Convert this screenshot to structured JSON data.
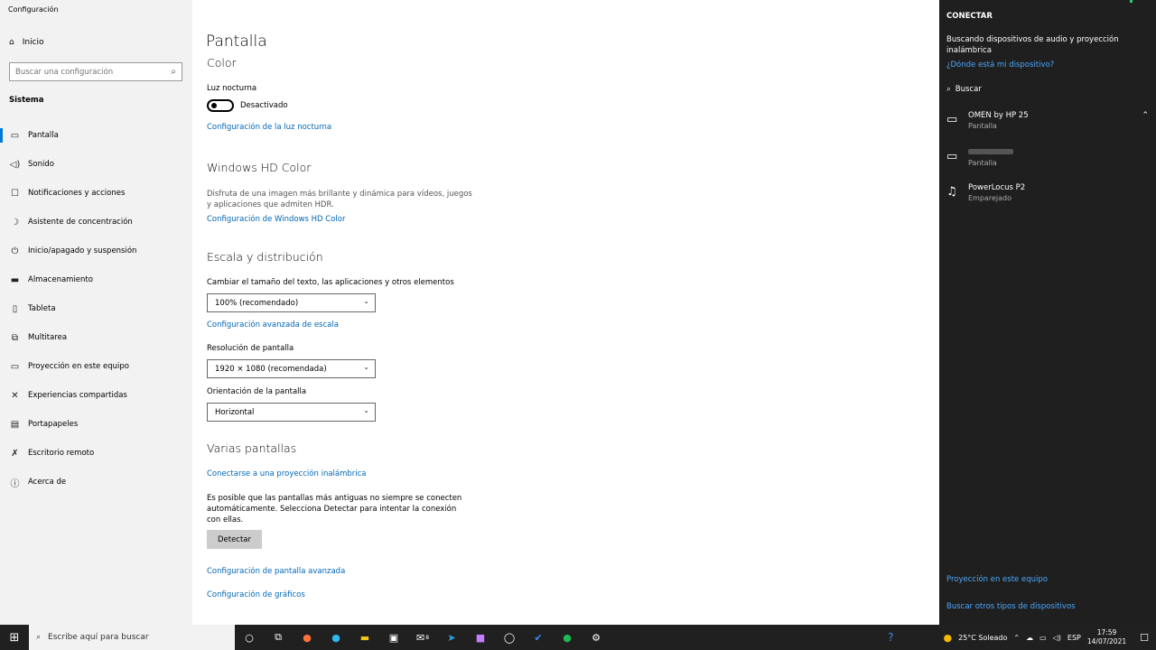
{
  "window": {
    "title": "Configuración"
  },
  "sidebar": {
    "home_label": "Inicio",
    "search_placeholder": "Buscar una configuración",
    "section_label": "Sistema",
    "items": [
      {
        "label": "Pantalla",
        "icon": "monitor-icon"
      },
      {
        "label": "Sonido",
        "icon": "speaker-icon"
      },
      {
        "label": "Notificaciones y acciones",
        "icon": "notification-icon"
      },
      {
        "label": "Asistente de concentración",
        "icon": "moon-icon"
      },
      {
        "label": "Inicio/apagado y suspensión",
        "icon": "power-icon"
      },
      {
        "label": "Almacenamiento",
        "icon": "storage-icon"
      },
      {
        "label": "Tableta",
        "icon": "tablet-icon"
      },
      {
        "label": "Multitarea",
        "icon": "multitask-icon"
      },
      {
        "label": "Proyección en este equipo",
        "icon": "projection-icon"
      },
      {
        "label": "Experiencias compartidas",
        "icon": "shared-icon"
      },
      {
        "label": "Portapapeles",
        "icon": "clipboard-icon"
      },
      {
        "label": "Escritorio remoto",
        "icon": "remote-icon"
      },
      {
        "label": "Acerca de",
        "icon": "info-icon"
      }
    ]
  },
  "main": {
    "title": "Pantalla",
    "color": {
      "heading": "Color",
      "night_light_label": "Luz nocturna",
      "night_light_state": "Desactivado",
      "night_light_link": "Configuración de la luz nocturna"
    },
    "hd_color": {
      "heading": "Windows HD Color",
      "description": "Disfruta de una imagen más brillante y dinámica para vídeos, juegos y aplicaciones que admiten HDR.",
      "link": "Configuración de Windows HD Color"
    },
    "scale": {
      "heading": "Escala y distribución",
      "size_label": "Cambiar el tamaño del texto, las aplicaciones y otros elementos",
      "size_value": "100% (recomendado)",
      "advanced_link": "Configuración avanzada de escala",
      "resolution_label": "Resolución de pantalla",
      "resolution_value": "1920 × 1080 (recomendada)",
      "orientation_label": "Orientación de la pantalla",
      "orientation_value": "Horizontal"
    },
    "multi": {
      "heading": "Varias pantallas",
      "wireless_link": "Conectarse a una proyección inalámbrica",
      "description": "Es posible que las pantallas más antiguas no siempre se conecten automáticamente. Selecciona Detectar para intentar la conexión con ellas.",
      "detect_button": "Detectar",
      "advanced_display_link": "Configuración de pantalla avanzada",
      "graphics_link": "Configuración de gráficos"
    }
  },
  "connect_panel": {
    "title": "CONECTAR",
    "description": "Buscando dispositivos de audio y proyección inalámbrica",
    "where_link": "¿Dónde está mi dispositivo?",
    "search_label": "Buscar",
    "devices": [
      {
        "name": "OMEN by HP 25",
        "type": "Pantalla",
        "icon": "monitor-icon"
      },
      {
        "name": "",
        "type": "Pantalla",
        "icon": "monitor-icon"
      },
      {
        "name": "PowerLocus P2",
        "type": "Emparejado",
        "icon": "headset-icon"
      }
    ],
    "projection_link": "Proyección en este equipo",
    "other_devices_link": "Buscar otros tipos de dispositivos"
  },
  "taskbar": {
    "search_placeholder": "Escribe aquí para buscar",
    "mail_badge": "8",
    "weather": "25°C Soleado",
    "language": "ESP",
    "time": "17:59",
    "date": "14/07/2021"
  }
}
